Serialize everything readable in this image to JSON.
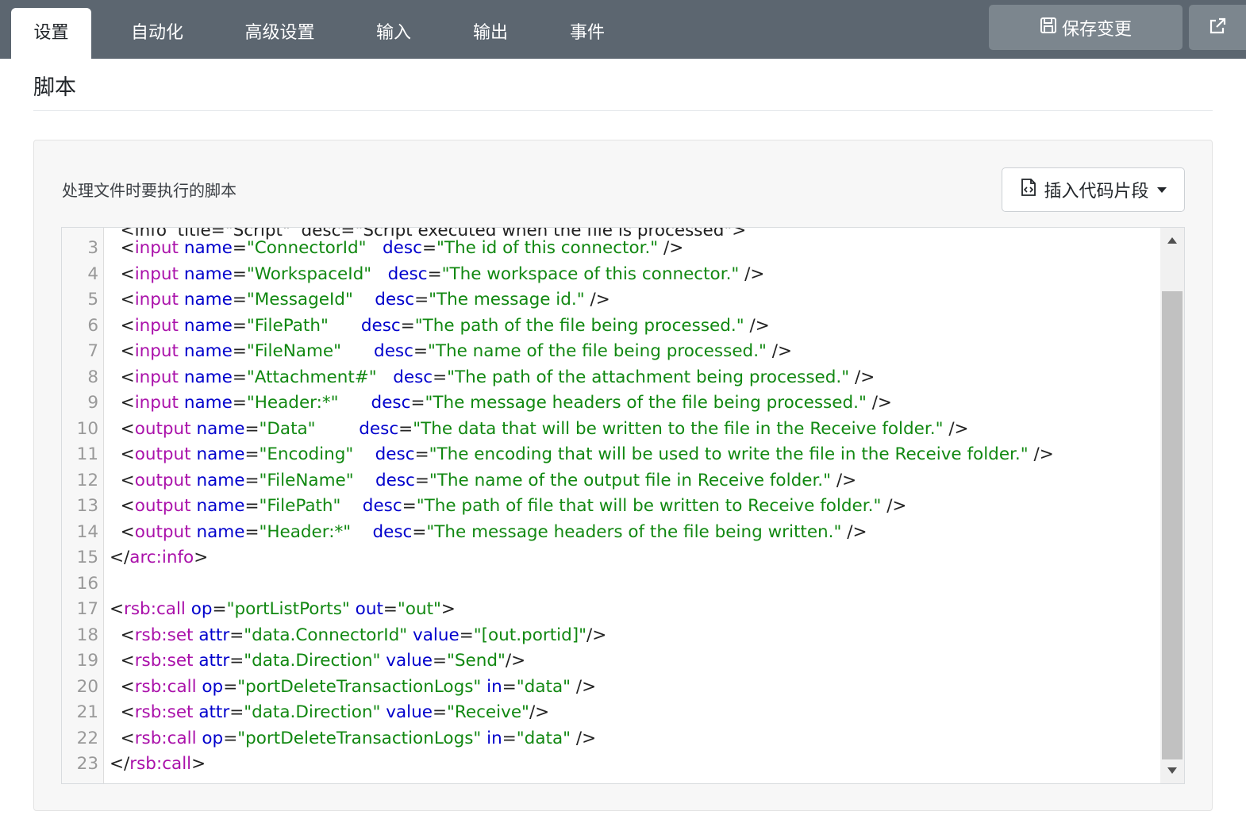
{
  "tabs": [
    {
      "label": "设置",
      "active": true
    },
    {
      "label": "自动化"
    },
    {
      "label": "高级设置"
    },
    {
      "label": "输入"
    },
    {
      "label": "输出"
    },
    {
      "label": "事件"
    }
  ],
  "toolbar": {
    "save_label": "保存变更"
  },
  "page": {
    "title": "脚本"
  },
  "script_card": {
    "label": "处理文件时要执行的脚本",
    "snippet_label": "插入代码片段"
  },
  "editor": {
    "lines": [
      {
        "n": "3",
        "indent": "  ",
        "kind": "input",
        "name": "\"ConnectorId\"",
        "pad": "   ",
        "desc": "\"The id of this connector.\""
      },
      {
        "n": "4",
        "indent": "  ",
        "kind": "input",
        "name": "\"WorkspaceId\"",
        "pad": "   ",
        "desc": "\"The workspace of this connector.\""
      },
      {
        "n": "5",
        "indent": "  ",
        "kind": "input",
        "name": "\"MessageId\"",
        "pad": "    ",
        "desc": "\"The message id.\""
      },
      {
        "n": "6",
        "indent": "  ",
        "kind": "input",
        "name": "\"FilePath\"",
        "pad": "      ",
        "desc": "\"The path of the file being processed.\""
      },
      {
        "n": "7",
        "indent": "  ",
        "kind": "input",
        "name": "\"FileName\"",
        "pad": "      ",
        "desc": "\"The name of the file being processed.\""
      },
      {
        "n": "8",
        "indent": "  ",
        "kind": "input",
        "name": "\"Attachment#\"",
        "pad": "   ",
        "desc": "\"The path of the attachment being processed.\""
      },
      {
        "n": "9",
        "indent": "  ",
        "kind": "input",
        "name": "\"Header:*\"",
        "pad": "      ",
        "desc": "\"The message headers of the file being processed.\""
      },
      {
        "n": "10",
        "indent": "  ",
        "kind": "output",
        "name": "\"Data\"",
        "pad": "        ",
        "desc": "\"The data that will be written to the file in the Receive folder.\""
      },
      {
        "n": "11",
        "indent": "  ",
        "kind": "output",
        "name": "\"Encoding\"",
        "pad": "    ",
        "desc": "\"The encoding that will be used to write the file in the Receive folder.\""
      },
      {
        "n": "12",
        "indent": "  ",
        "kind": "output",
        "name": "\"FileName\"",
        "pad": "    ",
        "desc": "\"The name of the output file in Receive folder.\""
      },
      {
        "n": "13",
        "indent": "  ",
        "kind": "output",
        "name": "\"FilePath\"",
        "pad": "    ",
        "desc": "\"The path of file that will be written to Receive folder.\""
      },
      {
        "n": "14",
        "indent": "  ",
        "kind": "output",
        "name": "\"Header:*\"",
        "pad": "    ",
        "desc": "\"The message headers of the file being written.\""
      }
    ],
    "tail": [
      {
        "n": "15",
        "html": "&lt;/<span class='t'>arc:info</span>&gt;"
      },
      {
        "n": "16",
        "html": ""
      },
      {
        "n": "17",
        "html": "&lt;<span class='t'>rsb:call</span> <span class='a'>op</span>=<span class='s'>\"portListPorts\"</span> <span class='a'>out</span>=<span class='s'>\"out\"</span>&gt;"
      },
      {
        "n": "18",
        "html": "  &lt;<span class='t'>rsb:set</span> <span class='a'>attr</span>=<span class='s'>\"data.ConnectorId\"</span> <span class='a'>value</span>=<span class='s'>\"[out.portid]\"</span>/&gt;"
      },
      {
        "n": "19",
        "html": "  &lt;<span class='t'>rsb:set</span> <span class='a'>attr</span>=<span class='s'>\"data.Direction\"</span> <span class='a'>value</span>=<span class='s'>\"Send\"</span>/&gt;"
      },
      {
        "n": "20",
        "html": "  &lt;<span class='t'>rsb:call</span> <span class='a'>op</span>=<span class='s'>\"portDeleteTransactionLogs\"</span> <span class='a'>in</span>=<span class='s'>\"data\"</span> /&gt;"
      },
      {
        "n": "21",
        "html": "  &lt;<span class='t'>rsb:set</span> <span class='a'>attr</span>=<span class='s'>\"data.Direction\"</span> <span class='a'>value</span>=<span class='s'>\"Receive\"</span>/&gt;"
      },
      {
        "n": "22",
        "html": "  &lt;<span class='t'>rsb:call</span> <span class='a'>op</span>=<span class='s'>\"portDeleteTransactionLogs\"</span> <span class='a'>in</span>=<span class='s'>\"data\"</span> /&gt;"
      },
      {
        "n": "23",
        "html": "&lt;/<span class='t'>rsb:call</span>&gt;"
      }
    ]
  },
  "colors": {
    "topbar": "#5c6670",
    "tag": "#aa11aa",
    "attribute": "#0000cc",
    "string": "#118811"
  },
  "icons": {
    "save": "floppy-disk-icon",
    "external": "external-link-icon",
    "snippet": "file-code-icon"
  }
}
